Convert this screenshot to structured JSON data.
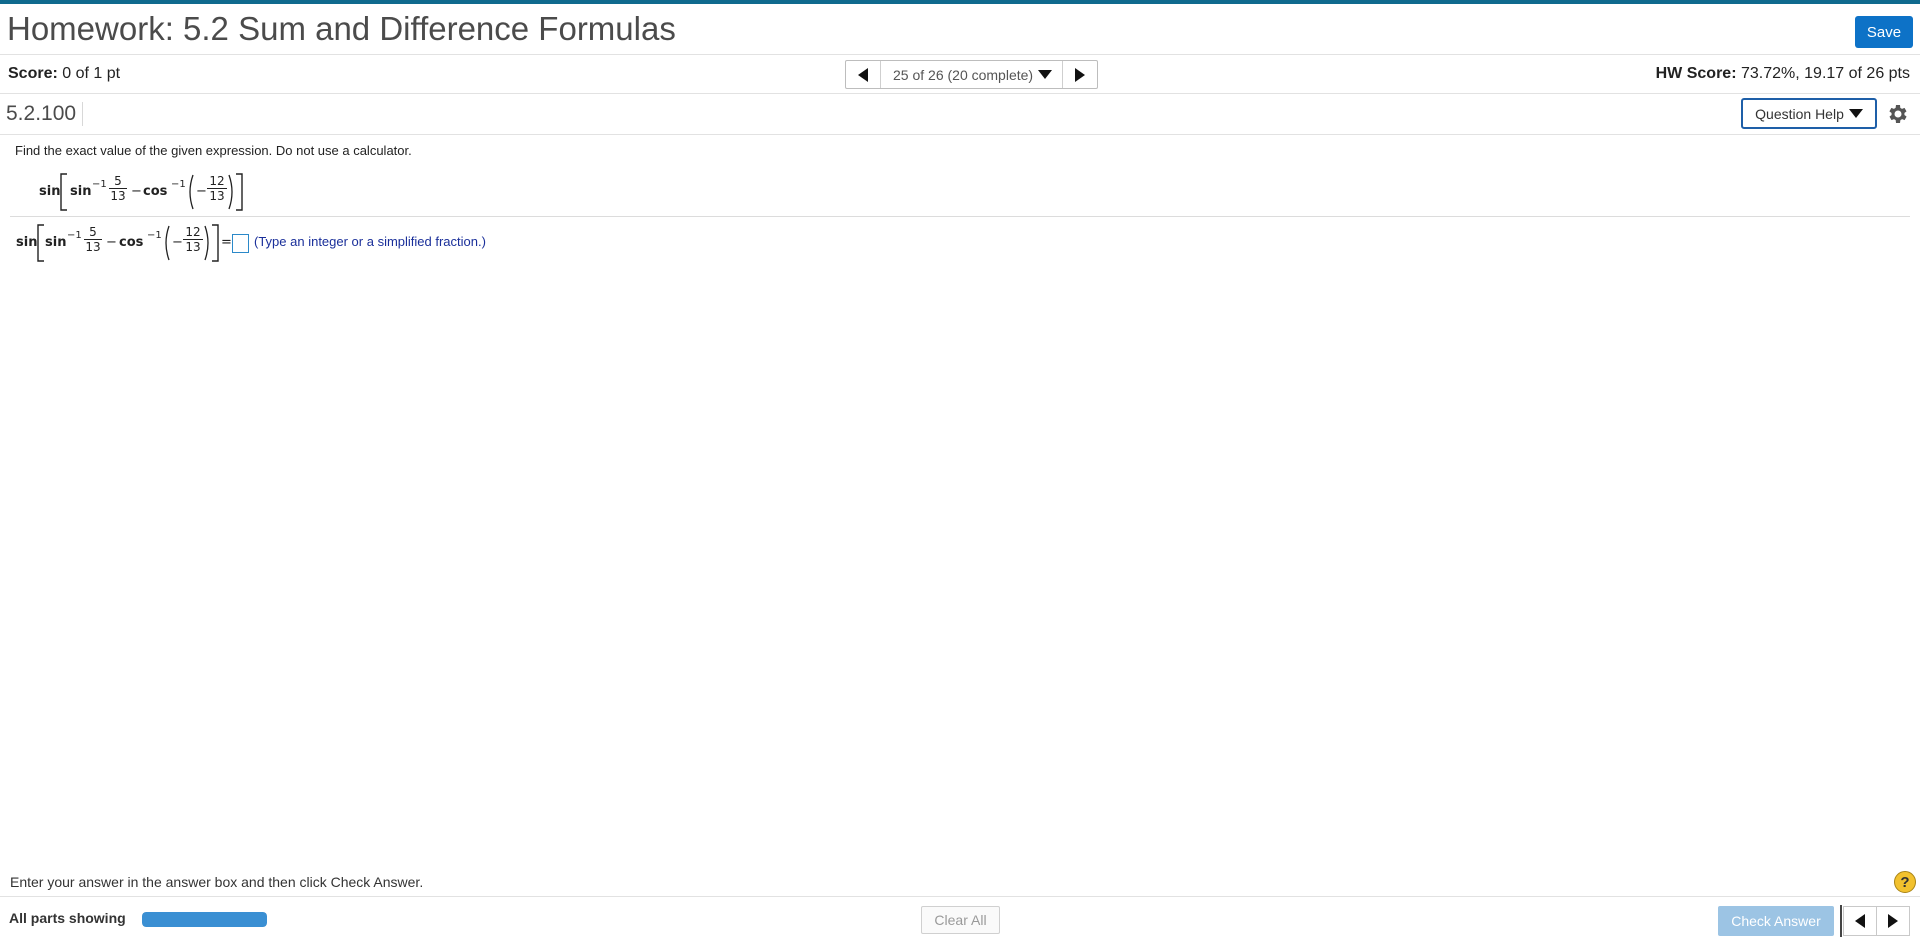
{
  "header": {
    "title": "Homework: 5.2 Sum and Difference Formulas",
    "save_label": "Save"
  },
  "score_bar": {
    "score_label": "Score:",
    "score_value": "0 of 1 pt",
    "navigator_label": "25 of 26 (20 complete)",
    "hw_score_label": "HW Score:",
    "hw_score_value": "73.72%, 19.17 of 26 pts"
  },
  "question": {
    "id": "5.2.100",
    "help_label": "Question Help",
    "instructions": "Find the exact value of the given expression. Do not use a calculator.",
    "expression": {
      "outer_fn": "sin",
      "fn1": "sin",
      "exp1": "−1",
      "frac1_num": "5",
      "frac1_den": "13",
      "minus": "−",
      "fn2": "cos",
      "exp2": "−1",
      "neg": "−",
      "frac2_num": "12",
      "frac2_den": "13"
    },
    "equals": "=",
    "answer_value": "",
    "answer_hint": "(Type an integer or a simplified fraction.)"
  },
  "footer": {
    "message": "Enter your answer in the answer box and then click Check Answer.",
    "help_symbol": "?",
    "parts_label": "All parts showing",
    "progress_fraction": 1.0,
    "clear_label": "Clear All",
    "check_label": "Check Answer"
  },
  "colors": {
    "top_accent": "#0f6a8e",
    "save_button": "#0d72c7",
    "progress_fill": "#3a8fd3",
    "check_disabled": "#9cc4e4",
    "hint_text": "#1a2f9a"
  },
  "icons": {
    "prev": "triangle-left-icon",
    "next": "triangle-right-icon",
    "dropdown": "chevron-down-icon",
    "settings": "gear-icon",
    "help": "question-circle-icon"
  }
}
